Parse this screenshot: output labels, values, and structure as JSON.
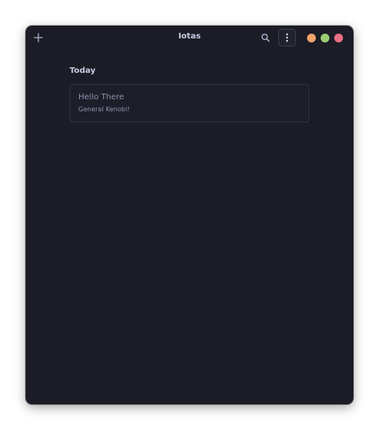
{
  "window": {
    "title": "Iotas"
  },
  "headerbar": {
    "new_icon": "plus-icon",
    "search_icon": "search-icon",
    "menu_icon": "vertical-ellipsis-icon"
  },
  "window_controls": {
    "minimize_color": "#f2a36a",
    "maximize_color": "#9ccc74",
    "close_color": "#ea6f82"
  },
  "notes": {
    "section_heading": "Today",
    "items": [
      {
        "title": "Hello There",
        "preview": "General Kenobi!"
      }
    ]
  },
  "colors": {
    "background": "#1b1c26",
    "text": "#c9cbe0",
    "muted_text": "#8f93ae",
    "card_border": "#30323f"
  }
}
